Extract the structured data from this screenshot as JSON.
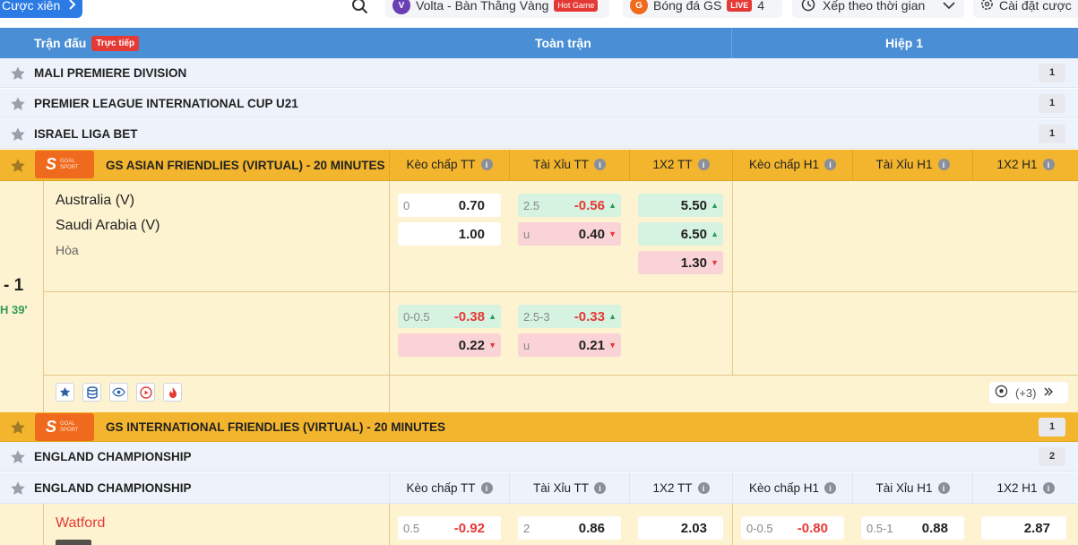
{
  "topbar": {
    "parlay_label": "Cược xiên",
    "game1_label": "Volta - Bàn Thắng Vàng",
    "game1_badge": "Hot Game",
    "game2_label": "Bóng đá GS",
    "game2_badge": "LIVE",
    "game2_count": "4",
    "sort_label": "Xếp theo thời gian",
    "settings_label": "Cài đặt cược"
  },
  "header": {
    "matches_label": "Trận đấu",
    "live_badge": "Trực tiếp",
    "full_match": "Toàn trận",
    "half1": "Hiệp 1"
  },
  "columns": [
    "Kèo chấp TT",
    "Tài Xỉu TT",
    "1X2 TT",
    "Kèo chấp H1",
    "Tài Xỉu H1",
    "1X2 H1"
  ],
  "leagues": [
    {
      "name": "MALI PREMIERE DIVISION",
      "count": "1"
    },
    {
      "name": "PREMIER LEAGUE INTERNATIONAL CUP U21",
      "count": "1"
    },
    {
      "name": "ISRAEL LIGA BET",
      "count": "1"
    },
    {
      "name": "GS ASIAN FRIENDLIES (VIRTUAL) - 20 MINUTES"
    },
    {
      "name": "GS INTERNATIONAL FRIENDLIES (VIRTUAL) - 20 MINUTES",
      "count": "1"
    },
    {
      "name": "ENGLAND CHAMPIONSHIP",
      "count": "2"
    },
    {
      "name": "ENGLAND CHAMPIONSHIP"
    }
  ],
  "logo": {
    "big": "S",
    "small1": "GOAL",
    "small2": "SPORT"
  },
  "match1": {
    "home": "Australia (V)",
    "away": "Saudi Arabia (V)",
    "draw": "Hòa",
    "score": "- 1",
    "time": "H 39'",
    "more": "(+3)",
    "row1": {
      "hcap": [
        {
          "label": "0",
          "value": "0.70"
        },
        {
          "label": "",
          "value": "1.00"
        }
      ],
      "ou": [
        {
          "label": "2.5",
          "value": "-0.56"
        },
        {
          "label": "u",
          "value": "0.40"
        }
      ],
      "x12": [
        "5.50",
        "6.50",
        "1.30"
      ]
    },
    "row2": {
      "hcap": [
        {
          "label": "0-0.5",
          "value": "-0.38"
        },
        {
          "label": "",
          "value": "0.22"
        }
      ],
      "ou": [
        {
          "label": "2.5-3",
          "value": "-0.33"
        },
        {
          "label": "u",
          "value": "0.21"
        }
      ]
    }
  },
  "match2": {
    "home": "Watford",
    "hcap_label": "0.5",
    "hcap_value": "-0.92",
    "ou_label": "2",
    "ou_value": "0.86",
    "x12": "2.03",
    "h1_hcap_label": "0-0.5",
    "h1_hcap_value": "-0.80",
    "h1_ou_label": "0.5-1",
    "h1_ou_value": "0.88",
    "h1_x12": "2.87"
  }
}
